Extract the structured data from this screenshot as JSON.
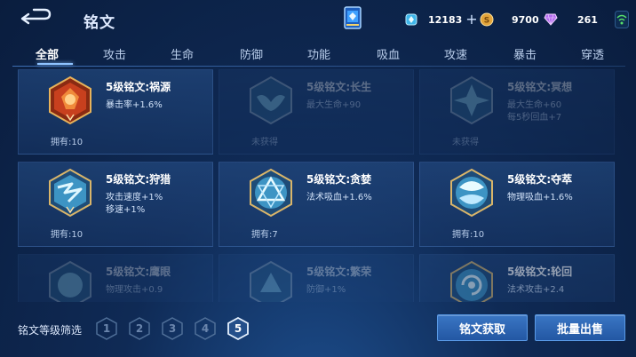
{
  "header": {
    "title": "铭文",
    "resources": {
      "ticket": "12183",
      "gold": "9700",
      "gem": "261"
    }
  },
  "tabs": [
    "全部",
    "攻击",
    "生命",
    "防御",
    "功能",
    "吸血",
    "攻速",
    "暴击",
    "穿透"
  ],
  "active_tab": 0,
  "cards": [
    {
      "name": "5级铭文:祸源",
      "effects": [
        "暴击率+1.6%"
      ],
      "status": "拥有:10",
      "state": "owned",
      "theme": "red"
    },
    {
      "name": "5级铭文:长生",
      "effects": [
        "最大生命+90"
      ],
      "status": "未获得",
      "state": "locked",
      "theme": "blue"
    },
    {
      "name": "5级铭文:冥想",
      "effects": [
        "最大生命+60",
        "每5秒回血+7"
      ],
      "status": "未获得",
      "state": "locked",
      "theme": "blue"
    },
    {
      "name": "5级铭文:狩猎",
      "effects": [
        "攻击速度+1%",
        "移速+1%"
      ],
      "status": "拥有:10",
      "state": "owned",
      "theme": "blue"
    },
    {
      "name": "5级铭文:贪婪",
      "effects": [
        "法术吸血+1.6%"
      ],
      "status": "拥有:7",
      "state": "owned",
      "theme": "blue"
    },
    {
      "name": "5级铭文:夺萃",
      "effects": [
        "物理吸血+1.6%"
      ],
      "status": "拥有:10",
      "state": "owned",
      "theme": "blue"
    },
    {
      "name": "5级铭文:鹰眼",
      "effects": [
        "物理攻击+0.9"
      ],
      "status": "",
      "state": "faded-locked",
      "theme": "blue"
    },
    {
      "name": "5级铭文:繁荣",
      "effects": [
        "防御+1%"
      ],
      "status": "",
      "state": "faded-locked",
      "theme": "blue"
    },
    {
      "name": "5级铭文:轮回",
      "effects": [
        "法术攻击+2.4"
      ],
      "status": "",
      "state": "faded",
      "theme": "blue"
    }
  ],
  "filter": {
    "label": "铭文等级筛选",
    "levels": [
      "1",
      "2",
      "3",
      "4",
      "5"
    ],
    "active_level": "5"
  },
  "buttons": {
    "get": "铭文获取",
    "sell": "批量出售"
  },
  "colors": {
    "accent": "#8fc3ff",
    "button": "#2f67b5",
    "red_emblem": "#c8401e",
    "blue_emblem": "#5fc2e6"
  }
}
